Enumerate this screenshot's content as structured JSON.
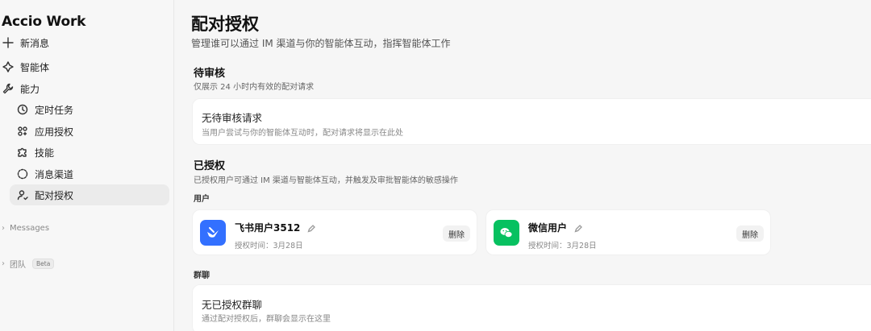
{
  "app": {
    "name": "Accio Work"
  },
  "sidebar": {
    "new_message": "新消息",
    "agents": "智能体",
    "abilities": "能力",
    "sub_items": [
      "定时任务",
      "应用授权",
      "技能",
      "消息渠道",
      "配对授权"
    ],
    "messages_group": "Messages",
    "team_group": "团队",
    "team_badge": "Beta"
  },
  "page": {
    "title": "配对授权",
    "subtitle": "管理谁可以通过 IM 渠道与你的智能体互动，指挥智能体工作"
  },
  "pending": {
    "title": "待审核",
    "subtitle": "仅展示 24 小时内有效的配对请求",
    "empty_title": "无待审核请求",
    "empty_sub": "当用户尝试与你的智能体互动时，配对请求将显示在此处"
  },
  "authorized": {
    "title": "已授权",
    "subtitle": "已授权用户可通过 IM 渠道与智能体互动，并触发及审批智能体的敏感操作",
    "users_label": "用户",
    "users": [
      {
        "name": "飞书用户3512",
        "date": "授权时间：3月28日",
        "delete": "删除",
        "color": "#3370ff"
      },
      {
        "name": "微信用户",
        "date": "授权时间：3月28日",
        "delete": "删除",
        "color": "#07c160"
      }
    ],
    "groups_label": "群聊",
    "groups_empty_title": "无已授权群聊",
    "groups_empty_sub": "通过配对授权后，群聊会显示在这里"
  }
}
